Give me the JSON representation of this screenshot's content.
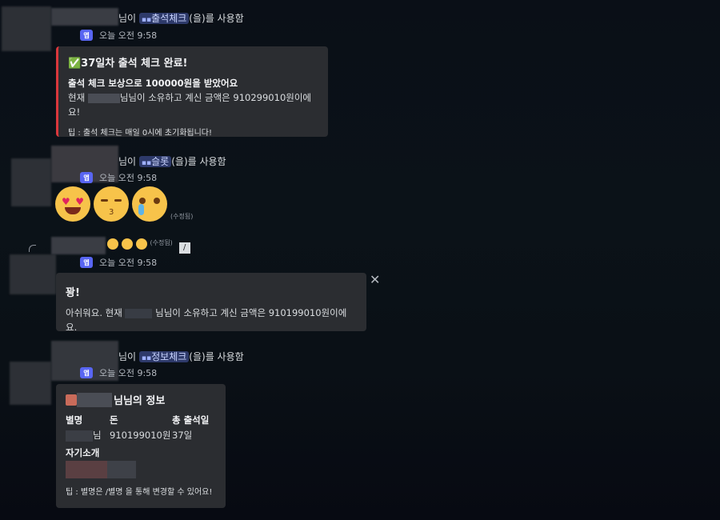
{
  "messages": [
    {
      "header_suffix": "님이",
      "command": "출석체크",
      "header_tail": "(을)를 사용함",
      "app_badge": "앱",
      "time": "오늘 오전 9:58",
      "embed": {
        "title": "✅37일차 출석 체크 완료!",
        "line1": "출석 체크 보상으로 100000원을 받았어요",
        "line2_prefix": "현재",
        "line2_suffix": "님님이 소유하고 계신 금액은 910299010원이에요!",
        "tip": "팁 : 출석 체크는 매일 0시에 초기화됩니다!"
      }
    },
    {
      "header_suffix": "님이",
      "command": "슬롯",
      "header_tail": "(을)를 사용함",
      "app_badge": "앱",
      "time": "오늘 오전 9:58",
      "edited": "(수정됨)"
    },
    {
      "edited": "(수정됨)",
      "app_badge": "앱",
      "time": "오늘 오전 9:58",
      "embed": {
        "title": "꽝!",
        "line_prefix": "아쉬워요. 현재",
        "line_suffix": "님님이 소유하고 계신 금액은 910199010원이에요.",
        "close": "✕"
      }
    },
    {
      "header_suffix": "님이",
      "command": "정보체크",
      "header_tail": "(을)를 사용함",
      "app_badge": "앱",
      "time": "오늘 오전 9:58",
      "embed": {
        "title_suffix": "님님의 정보",
        "col_nick": "별명",
        "col_money": "돈",
        "col_days": "총 출석일",
        "val_nick_suffix": "님",
        "val_money": "910199010원",
        "val_days": "37일",
        "intro_label": "자기소개",
        "tip": "팁 : 별명은 /별명 을 통해 변경할 수 있어요!"
      }
    }
  ]
}
